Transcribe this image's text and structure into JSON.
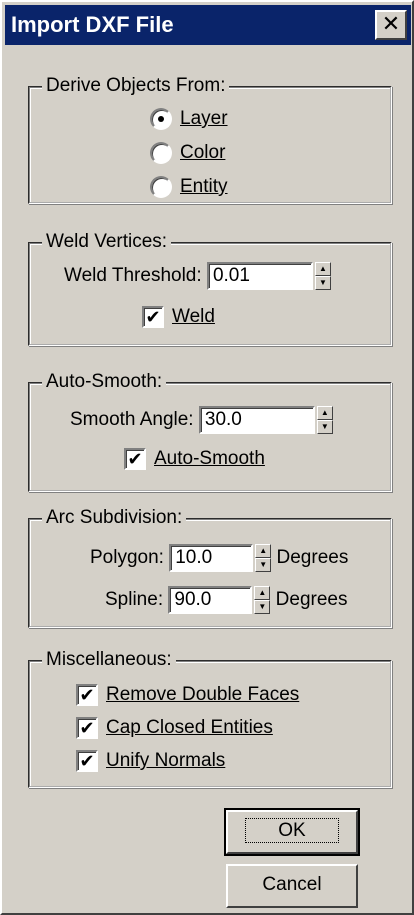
{
  "window": {
    "title": "Import DXF File",
    "close_glyph": "✕"
  },
  "derive": {
    "legend": "Derive Objects From:",
    "options": [
      {
        "label": "Layer",
        "selected": true
      },
      {
        "label": "Color",
        "selected": false
      },
      {
        "label": "Entity",
        "selected": false
      }
    ]
  },
  "weld": {
    "legend": "Weld Vertices:",
    "threshold_label": "Weld Threshold:",
    "threshold_value": "0.01",
    "weld_label": "Weld",
    "weld_checked": true
  },
  "autosmooth": {
    "legend": "Auto-Smooth:",
    "angle_label": "Smooth Angle:",
    "angle_value": "30.0",
    "check_label": "Auto-Smooth",
    "checked": true
  },
  "arc": {
    "legend": "Arc Subdivision:",
    "polygon_label": "Polygon:",
    "polygon_value": "10.0",
    "spline_label": "Spline:",
    "spline_value": "90.0",
    "unit": "Degrees"
  },
  "misc": {
    "legend": "Miscellaneous:",
    "items": [
      {
        "label": "Remove Double Faces",
        "checked": true
      },
      {
        "label": "Cap Closed Entities",
        "checked": true
      },
      {
        "label": "Unify Normals",
        "checked": true
      }
    ]
  },
  "buttons": {
    "ok": "OK",
    "cancel": "Cancel"
  },
  "colors": {
    "face": "#d4d0c8",
    "title_bg": "#0a246a",
    "title_fg": "#ffffff"
  }
}
